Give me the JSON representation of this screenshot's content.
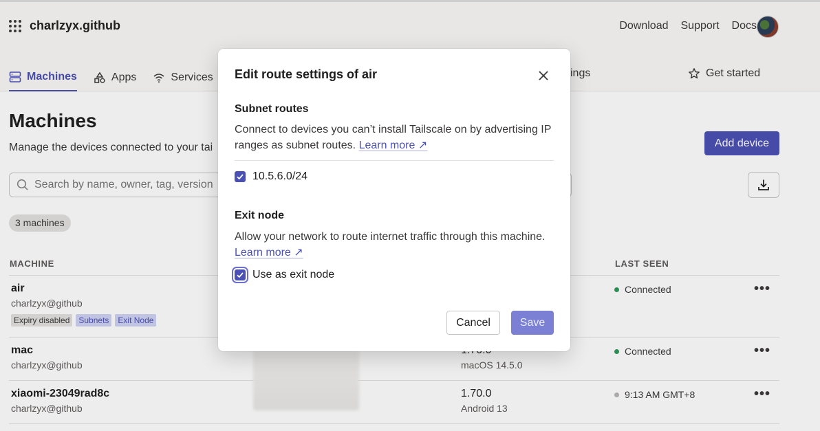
{
  "header": {
    "brand": "charlzyx.github",
    "nav": [
      "Download",
      "Support",
      "Docs"
    ],
    "tabs": [
      {
        "label": "Machines",
        "icon": "server-icon",
        "active": true
      },
      {
        "label": "Apps",
        "icon": "apps-icon"
      },
      {
        "label": "Services",
        "icon": "wifi-icon"
      }
    ],
    "tab_partial": "ings",
    "get_started": "Get started"
  },
  "main": {
    "title": "Machines",
    "subtitle": "Manage the devices connected to your tai",
    "add_device": "Add device",
    "search_placeholder": "Search by name, owner, tag, version",
    "count_badge": "3 machines",
    "columns": {
      "machine": "MACHINE",
      "last_seen": "LAST SEEN"
    },
    "rows": [
      {
        "name": "air",
        "owner": "charlzyx@github",
        "tags": [
          "Expiry disabled",
          "Subnets",
          "Exit Node"
        ],
        "version": "",
        "os": "",
        "status": "Connected",
        "status_color": "#2b9a5a"
      },
      {
        "name": "mac",
        "owner": "charlzyx@github",
        "tags": [],
        "version": "1.70.0",
        "os": "macOS 14.5.0",
        "status": "Connected",
        "status_color": "#2b9a5a"
      },
      {
        "name": "xiaomi-23049rad8c",
        "owner": "charlzyx@github",
        "tags": [],
        "version": "1.70.0",
        "os": "Android 13",
        "status": "9:13 AM GMT+8",
        "status_color": "#b9b6b5"
      }
    ],
    "more_glyph": "•••"
  },
  "modal": {
    "title": "Edit route settings of air",
    "subnet_title": "Subnet routes",
    "subnet_text": "Connect to devices you can’t install Tailscale on by advertising IP ranges as subnet routes.",
    "learn_more": "Learn more ↗",
    "subnet_route": "10.5.6.0/24",
    "exit_title": "Exit node",
    "exit_text": "Allow your network to route internet traffic through this machine.",
    "exit_checkbox": "Use as exit node",
    "cancel": "Cancel",
    "save": "Save"
  },
  "colors": {
    "accent": "#4b50b5",
    "connected": "#2b9a5a"
  }
}
